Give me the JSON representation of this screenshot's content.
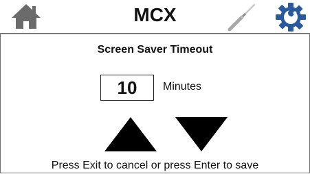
{
  "header": {
    "title": "MCX",
    "left_icon": "home-icon",
    "right_icons": [
      "tools-icon",
      "settings-icon"
    ]
  },
  "screen": {
    "subtitle": "Screen Saver Timeout",
    "value": "10",
    "unit": "Minutes",
    "increase_icon": "up-arrow",
    "decrease_icon": "down-arrow",
    "instruction": "Press Exit to cancel or press Enter to save"
  },
  "colors": {
    "home_icon": "#6b6b6b",
    "settings_icon": "#2a5a9e",
    "tools_icon": "#bdbdbd",
    "text": "#111111",
    "header_border": "#7a7a7a"
  }
}
